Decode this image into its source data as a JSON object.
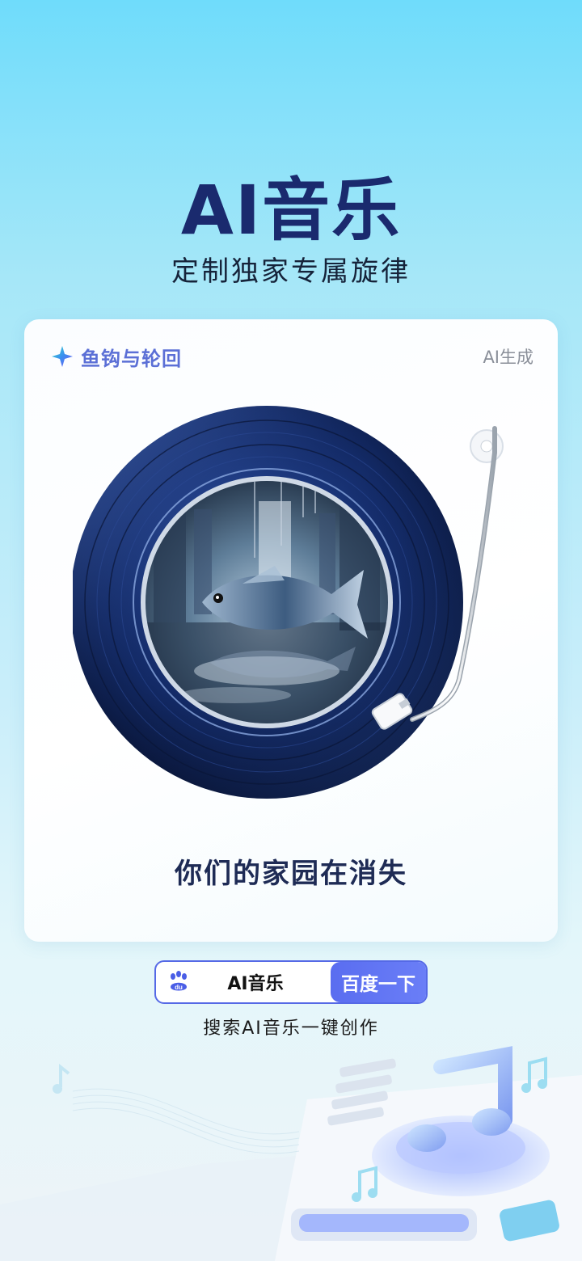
{
  "hero": {
    "title": "AI音乐",
    "subtitle": "定制独家专属旋律"
  },
  "card": {
    "song_title": "鱼钩与轮回",
    "tag": "AI生成",
    "lyric": "你们的家园在消失"
  },
  "search": {
    "query": "AI音乐",
    "button_label": "百度一下",
    "hint": "搜索AI音乐一键创作"
  },
  "colors": {
    "accent": "#5a6df0",
    "title": "#1a2a6e",
    "song_title": "#5b6fd6"
  },
  "icons": {
    "sparkle": "sparkle-icon",
    "baidu": "baidu-paw-icon",
    "music_note": "music-note-icon"
  }
}
